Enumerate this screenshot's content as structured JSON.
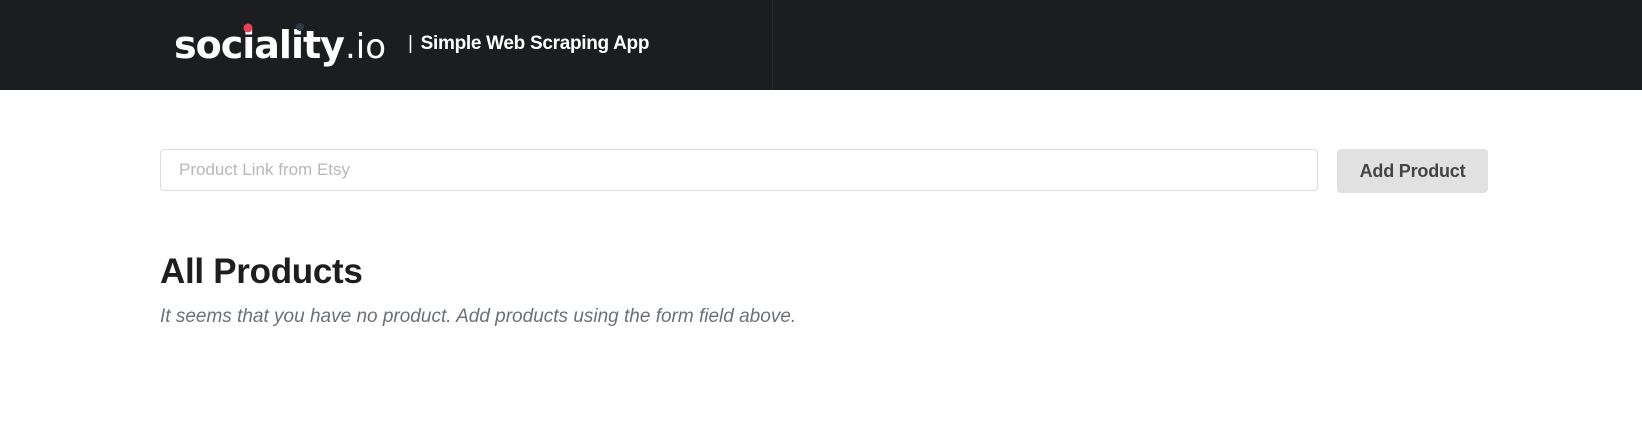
{
  "header": {
    "logo": {
      "brand": "sociality",
      "tld": ".io",
      "dot_color": "#e8425a",
      "alt_dot_color": "#2a3a4a"
    },
    "separator": "|",
    "tagline": "Simple Web Scraping App",
    "background": "#1c1d1f"
  },
  "form": {
    "input_placeholder": "Product Link from Etsy",
    "input_value": "",
    "button_label": "Add Product"
  },
  "products": {
    "title": "All Products",
    "empty_message": "It seems that you have no product. Add products using the form field above.",
    "items": []
  }
}
